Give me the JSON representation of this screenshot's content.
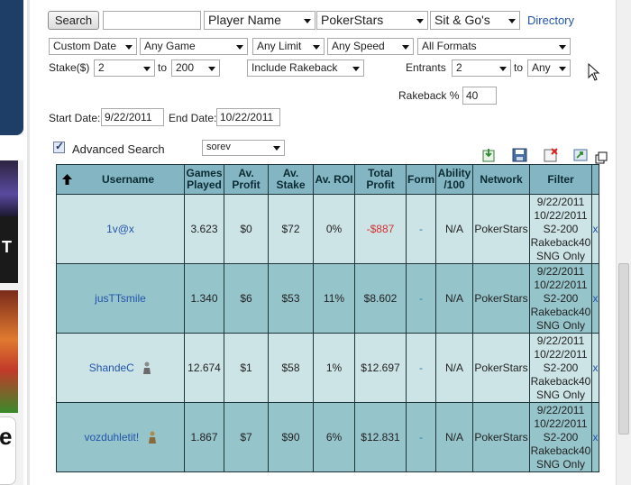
{
  "toolbar": {
    "search_label": "Search",
    "search_value": "",
    "search_type": "Player Name",
    "site": "PokerStars",
    "game_mode": "Sit & Go's",
    "directory_label": "Directory"
  },
  "filters": {
    "date_mode": "Custom Date",
    "game": "Any Game",
    "limit": "Any Limit",
    "speed": "Any Speed",
    "formats": "All Formats",
    "stake_label": "Stake($)",
    "stake_from": "2",
    "to_label": "to",
    "stake_to": "200",
    "rakeback_mode": "Include Rakeback",
    "entrants_label": "Entrants",
    "entrants_from": "2",
    "entrants_to": "Any",
    "rakeback_pct_label": "Rakeback %",
    "rakeback_pct": "40",
    "start_date_label": "Start Date:",
    "start_date": "9/22/2011",
    "end_date_label": "End Date:",
    "end_date": "10/22/2011"
  },
  "advanced": {
    "label": "Advanced Search",
    "checked": true,
    "sort_value": "sorev"
  },
  "table": {
    "headers": {
      "username": "Username",
      "games": "Games Played",
      "avg_profit": "Av. Profit",
      "avg_stake": "Av. Stake",
      "avg_roi": "Av. ROI",
      "total_profit": "Total Profit",
      "form": "Form",
      "ability": "Ability /100",
      "network": "Network",
      "filter": "Filter"
    },
    "rows": [
      {
        "username": "1v@x",
        "games": "3.623",
        "avg_profit": "$0",
        "avg_stake": "$72",
        "avg_roi": "0%",
        "total_profit": "-$887",
        "form": "-",
        "ability": "N/A",
        "network": "PokerStars",
        "f1": "9/22/2011",
        "f2": "10/22/2011",
        "f3": "S2-200",
        "f4": "Rakeback40",
        "f5": "SNG Only",
        "x": "x"
      },
      {
        "username": "jusTTsmile",
        "games": "1.340",
        "avg_profit": "$6",
        "avg_stake": "$53",
        "avg_roi": "11%",
        "total_profit": "$8.602",
        "form": "-",
        "ability": "N/A",
        "network": "PokerStars",
        "f1": "9/22/2011",
        "f2": "10/22/2011",
        "f3": "S2-200",
        "f4": "Rakeback40",
        "f5": "SNG Only",
        "x": "x"
      },
      {
        "username": "ShandeC",
        "games": "12.674",
        "avg_profit": "$1",
        "avg_stake": "$58",
        "avg_roi": "1%",
        "total_profit": "$12.697",
        "form": "-",
        "ability": "N/A",
        "network": "PokerStars",
        "f1": "9/22/2011",
        "f2": "10/22/2011",
        "f3": "S2-200",
        "f4": "Rakeback40",
        "f5": "SNG Only",
        "x": "x"
      },
      {
        "username": "vozduhletit!",
        "games": "1.867",
        "avg_profit": "$7",
        "avg_stake": "$90",
        "avg_roi": "6%",
        "total_profit": "$12.831",
        "form": "-",
        "ability": "N/A",
        "network": "PokerStars",
        "f1": "9/22/2011",
        "f2": "10/22/2011",
        "f3": "S2-200",
        "f4": "Rakeback40",
        "f5": "SNG Only",
        "x": "x"
      }
    ]
  },
  "icons": [
    "sort-up-arrow-icon",
    "export-icon",
    "save-icon",
    "delete-icon",
    "refresh-icon",
    "popout-icon",
    "player-avatar-icon",
    "mouse-cursor-icon"
  ],
  "colors": {
    "header_bg": "#83b6c2",
    "row_light": "#cde4e6",
    "row_dark": "#96c4cb",
    "link": "#2255aa",
    "negative": "#d23232"
  }
}
